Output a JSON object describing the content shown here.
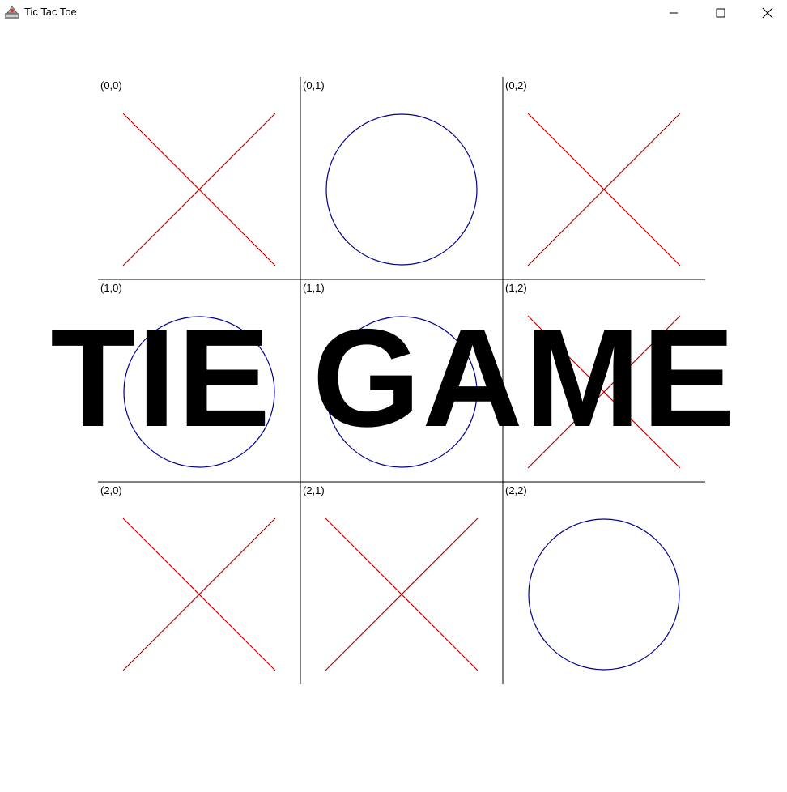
{
  "window": {
    "title": "Tic Tac Toe",
    "icon": "java-app-icon",
    "controls": [
      "minimize-icon",
      "maximize-icon",
      "close-icon"
    ]
  },
  "board": {
    "cells": [
      {
        "row": 0,
        "col": 0,
        "label": "(0,0)",
        "mark": "X"
      },
      {
        "row": 0,
        "col": 1,
        "label": "(0,1)",
        "mark": "O"
      },
      {
        "row": 0,
        "col": 2,
        "label": "(0,2)",
        "mark": "X"
      },
      {
        "row": 1,
        "col": 0,
        "label": "(1,0)",
        "mark": "O"
      },
      {
        "row": 1,
        "col": 1,
        "label": "(1,1)",
        "mark": "O"
      },
      {
        "row": 1,
        "col": 2,
        "label": "(1,2)",
        "mark": "X"
      },
      {
        "row": 2,
        "col": 0,
        "label": "(2,0)",
        "mark": "X"
      },
      {
        "row": 2,
        "col": 1,
        "label": "(2,1)",
        "mark": "X"
      },
      {
        "row": 2,
        "col": 2,
        "label": "(2,2)",
        "mark": "O"
      }
    ],
    "x_color": "#c00000",
    "o_color": "#00008b",
    "grid_color": "#000000"
  },
  "result": {
    "text": "TIE GAME"
  }
}
